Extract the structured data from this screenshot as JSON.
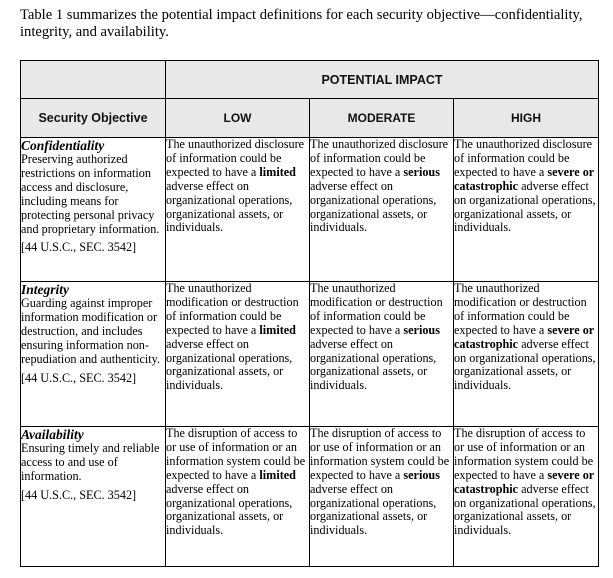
{
  "intro": "Table 1 summarizes the potential impact definitions for each security objective—confidentiality, integrity, and availability.",
  "table": {
    "header": {
      "group_label": "POTENTIAL IMPACT",
      "objective_label": "Security Objective",
      "levels": [
        "LOW",
        "MODERATE",
        "HIGH"
      ]
    },
    "rows": [
      {
        "title": "Confidentiality",
        "description": "Preserving authorized restrictions on information access and disclosure, including means for protecting personal privacy and proprietary information.",
        "reference": "[44 U.S.C., SEC. 3542]",
        "cells": [
          {
            "before": "The unauthorized disclosure of information could be expected to have a ",
            "emphasis": "limited",
            "after": " adverse effect on organizational operations, organizational assets, or individuals."
          },
          {
            "before": "The unauthorized disclosure of information could be expected to have a ",
            "emphasis": "serious",
            "after": " adverse effect on organizational operations, organizational assets, or individuals."
          },
          {
            "before": "The unauthorized disclosure of information could be expected to have a ",
            "emphasis": "severe or catastrophic",
            "after": " adverse effect on organizational operations, organizational assets, or individuals."
          }
        ]
      },
      {
        "title": "Integrity",
        "description": "Guarding against improper information modification or destruction, and includes ensuring information non-repudiation and authenticity.",
        "reference": "[44 U.S.C., SEC. 3542]",
        "cells": [
          {
            "before": "The unauthorized modification or destruction of information could be expected to have a ",
            "emphasis": "limited",
            "after": " adverse effect on organizational operations, organizational assets, or individuals."
          },
          {
            "before": "The unauthorized modification or destruction of information could be expected to have a ",
            "emphasis": "serious",
            "after": " adverse effect on organizational operations, organizational assets, or individuals."
          },
          {
            "before": "The unauthorized modification or destruction of information could be expected to have a ",
            "emphasis": "severe or catastrophic",
            "after": " adverse effect on organizational operations, organizational assets, or individuals."
          }
        ]
      },
      {
        "title": "Availability",
        "description": "Ensuring timely and reliable access to and use of information.",
        "reference": "[44 U.S.C., SEC. 3542]",
        "cells": [
          {
            "before": "The disruption of access to or use of information or an information system could be expected to have a ",
            "emphasis": "limited",
            "after": " adverse effect on organizational operations, organizational assets, or individuals."
          },
          {
            "before": "The disruption of access to or use of information or an information system could be expected to have a ",
            "emphasis": "serious",
            "after": " adverse effect on organizational operations, organizational assets, or individuals."
          },
          {
            "before": "The disruption of access to or use of information or an information system could be expected to have a ",
            "emphasis": "severe or catastrophic",
            "after": " adverse effect on organizational operations, organizational assets, or individuals."
          }
        ]
      }
    ]
  }
}
